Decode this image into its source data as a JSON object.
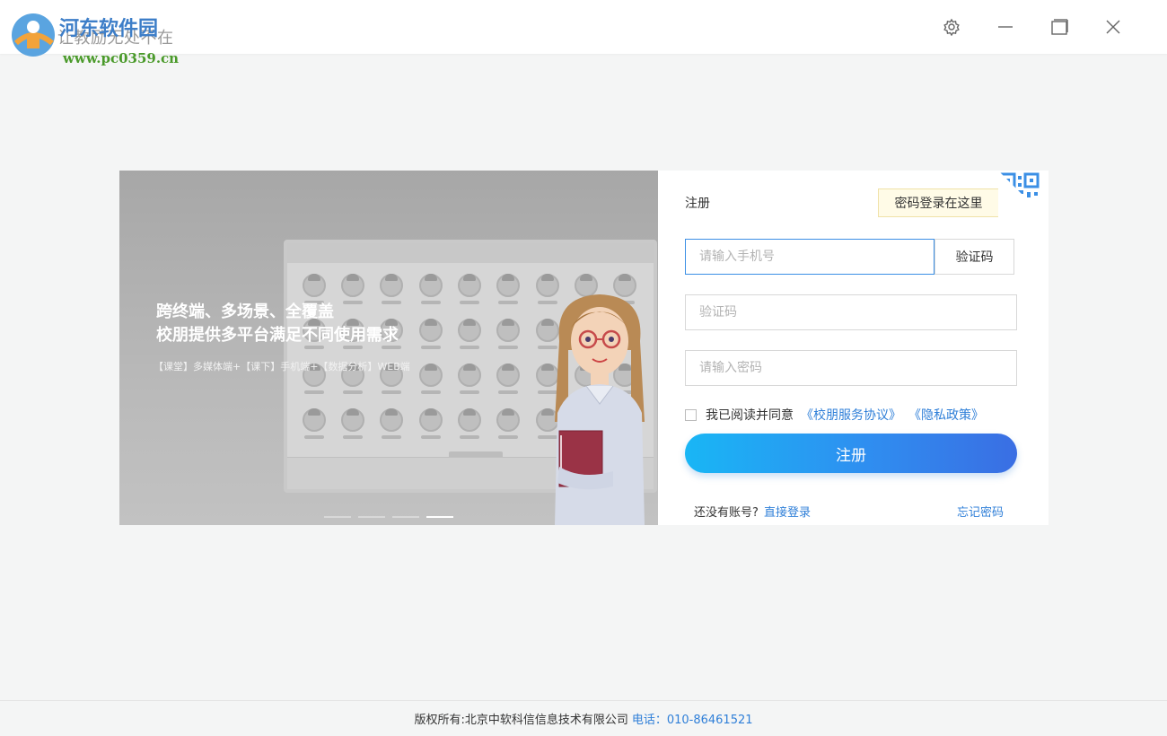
{
  "header": {
    "slogan": "让教励无处不在",
    "watermark_title": "河东软件园",
    "watermark_url": "www.pc0359.cn",
    "icons": [
      "settings-icon",
      "minimize-icon",
      "maximize-icon",
      "close-icon"
    ]
  },
  "banner": {
    "headline_1": "跨终端、多场景、全覆盖",
    "headline_2": "校朋提供多平台满足不同使用需求",
    "subline": "【课堂】多媒体端+【课下】手机端+【数据分析】WEB端",
    "slide_count": 4,
    "active_slide": 4
  },
  "form": {
    "title": "注册",
    "tooltip": "密码登录在这里",
    "phone_placeholder": "请输入手机号",
    "code_button": "验证码",
    "code_placeholder": "验证码",
    "password_placeholder": "请输入密码",
    "agree_text": "我已阅读并同意",
    "terms_link": "《校朋服务协议》",
    "privacy_link": "《隐私政策》",
    "submit_label": "注册",
    "have_account_text": "还没有账号?",
    "login_link": "直接登录",
    "forgot_link": "忘记密码"
  },
  "footer": {
    "copyright": "版权所有:北京中软科信信息技术有限公司",
    "phone": "电话：010-86461521"
  },
  "colors": {
    "accent": "#2f7fd8",
    "button_gradient_start": "#19b6f5",
    "button_gradient_end": "#3a6ee3",
    "page_bg": "#f4f5f5"
  }
}
